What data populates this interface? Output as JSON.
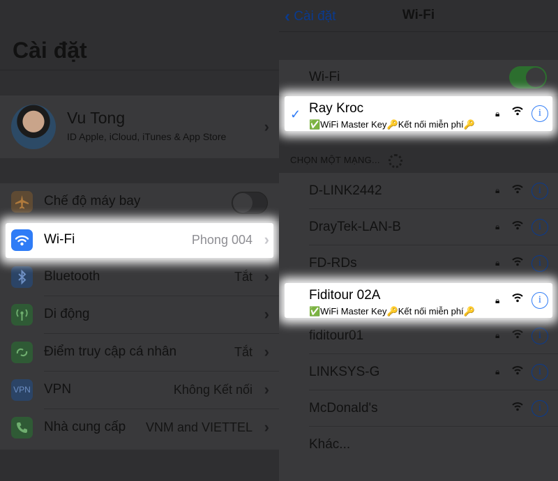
{
  "settings": {
    "title": "Cài đặt",
    "profile": {
      "name": "Vu Tong",
      "subtitle": "ID Apple, iCloud, iTunes & App Store"
    },
    "rows": [
      {
        "label": "Chế độ máy bay",
        "value": "",
        "icon": "airplane-icon",
        "color": "#f09a37"
      },
      {
        "label": "Wi-Fi",
        "value": "Phong 004",
        "icon": "wifi-icon",
        "color": "#2f7cf6"
      },
      {
        "label": "Bluetooth",
        "value": "Tắt",
        "icon": "bluetooth-icon",
        "color": "#2f7cf6"
      },
      {
        "label": "Di động",
        "value": "",
        "icon": "cellular-icon",
        "color": "#4cd964"
      },
      {
        "label": "Điểm truy cập cá nhân",
        "value": "Tắt",
        "icon": "hotspot-icon",
        "color": "#4cd964"
      },
      {
        "label": "VPN",
        "value": "Không Kết nối",
        "icon": "vpn-icon",
        "color": "#2f7cf6",
        "icon_text": "VPN"
      },
      {
        "label": "Nhà cung cấp",
        "value": "VNM and VIETTEL",
        "icon": "phone-icon",
        "color": "#4cd964"
      }
    ]
  },
  "wifi": {
    "back_label": "Cài đặt",
    "title": "Wi-Fi",
    "toggle_label": "Wi-Fi",
    "toggle_on": true,
    "connected": {
      "name": "Ray Kroc",
      "subtitle": "✅WiFi Master Key🔑Kết nối miễn phí🔑"
    },
    "section_header": "CHỌN MỘT MẠNG...",
    "networks": [
      {
        "name": "D-LINK2442",
        "locked": true
      },
      {
        "name": "DrayTek-LAN-B",
        "locked": true
      },
      {
        "name": "FD-RDs",
        "locked": true
      },
      {
        "name": "Fiditour 02A",
        "locked": true,
        "subtitle": "✅WiFi Master Key🔑Kết nối miễn phí🔑",
        "highlighted": true
      },
      {
        "name": "fiditour01",
        "locked": true
      },
      {
        "name": "LINKSYS-G",
        "locked": true
      },
      {
        "name": "McDonald's",
        "locked": false
      },
      {
        "name": "Khác...",
        "other": true
      }
    ]
  }
}
